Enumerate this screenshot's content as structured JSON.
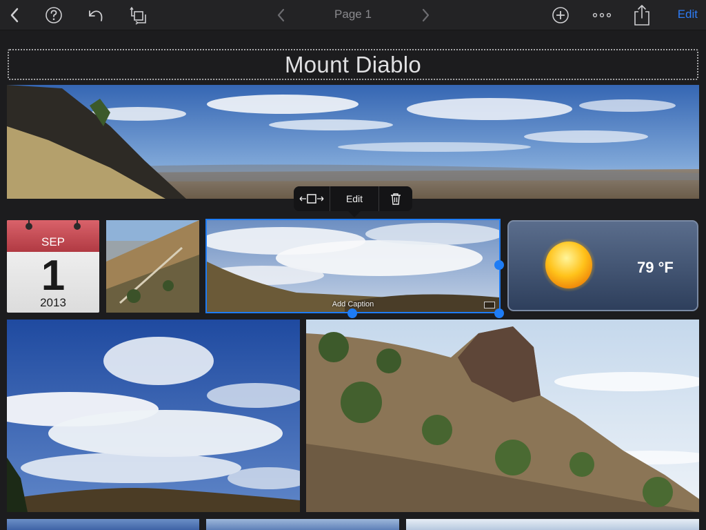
{
  "toolbar": {
    "page_label": "Page 1",
    "edit_label": "Edit",
    "icons": [
      "back-chevron-icon",
      "help-icon",
      "undo-icon",
      "rotate-icon",
      "previous-page-icon",
      "next-page-icon",
      "add-icon",
      "more-icon",
      "share-icon"
    ]
  },
  "journal": {
    "title": "Mount Diablo"
  },
  "calendar": {
    "month": "SEP",
    "day": "1",
    "year": "2013"
  },
  "weather": {
    "temperature": "79 °F",
    "icon": "sun-icon"
  },
  "selected_photo": {
    "caption_placeholder": "Add Caption"
  },
  "popover": {
    "edit_label": "Edit",
    "icons": [
      "resize-icon",
      "trash-icon"
    ]
  },
  "colors": {
    "accent": "#1e7cf5",
    "toolbar_bg": "#232325",
    "page_bg": "#1c1c1e"
  }
}
